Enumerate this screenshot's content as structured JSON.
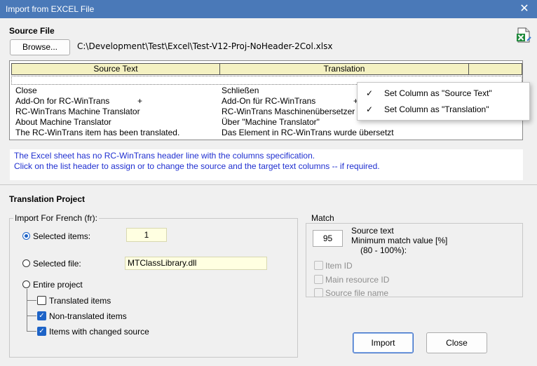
{
  "window": {
    "title": "Import from EXCEL File",
    "close_glyph": "✕"
  },
  "source_file": {
    "section_title": "Source File",
    "browse_label": "Browse...",
    "path": "C:\\Development\\Test\\Excel\\Test-V12-Proj-NoHeader-2Col.xlsx",
    "icon": "excel-file-icon"
  },
  "grid": {
    "headers": [
      "Source Text",
      "Translation"
    ],
    "rows": [
      {
        "source": "Close",
        "translation": "Schließen"
      },
      {
        "source": "Add-On for RC-WinTrans",
        "translation": "Add-On für RC-WinTrans"
      },
      {
        "source": "RC-WinTrans Machine Translator",
        "translation": "RC-WinTrans Maschinenübersetzer"
      },
      {
        "source": "About Machine Translator",
        "translation": "Über \"Machine Translator\""
      },
      {
        "source": "The RC-WinTrans item has been translated.",
        "translation": "Das Element in RC-WinTrans wurde übersetzt"
      }
    ],
    "plus": "+"
  },
  "context_menu": {
    "items": [
      {
        "check": "✓",
        "label": "Set Column as \"Source Text\""
      },
      {
        "check": "✓",
        "label": "Set Column as \"Translation\""
      }
    ]
  },
  "info": {
    "line1": "The Excel sheet has no RC-WinTrans header line with the columns specification.",
    "line2": "Click on the list header to assign or to change the source and the target text columns -- if required."
  },
  "translation_project": {
    "section_title": "Translation Project",
    "import_group_label": "Import For French (fr):",
    "selected_items_label": "Selected items:",
    "selected_items_value": "1",
    "selected_file_label": "Selected file:",
    "selected_file_value": "MTClassLibrary.dll",
    "entire_project_label": "Entire project",
    "translated_items_label": "Translated items",
    "non_translated_items_label": "Non-translated items",
    "changed_source_label": "Items with changed source"
  },
  "match": {
    "group_label": "Match",
    "value": "95",
    "source_text_label": "Source text",
    "min_label": "Minimum match value [%]",
    "range_label": "(80 - 100%):",
    "item_id_label": "Item ID",
    "main_resource_label": "Main resource ID",
    "source_file_name_label": "Source file name"
  },
  "buttons": {
    "import_label": "Import",
    "close_label": "Close"
  }
}
